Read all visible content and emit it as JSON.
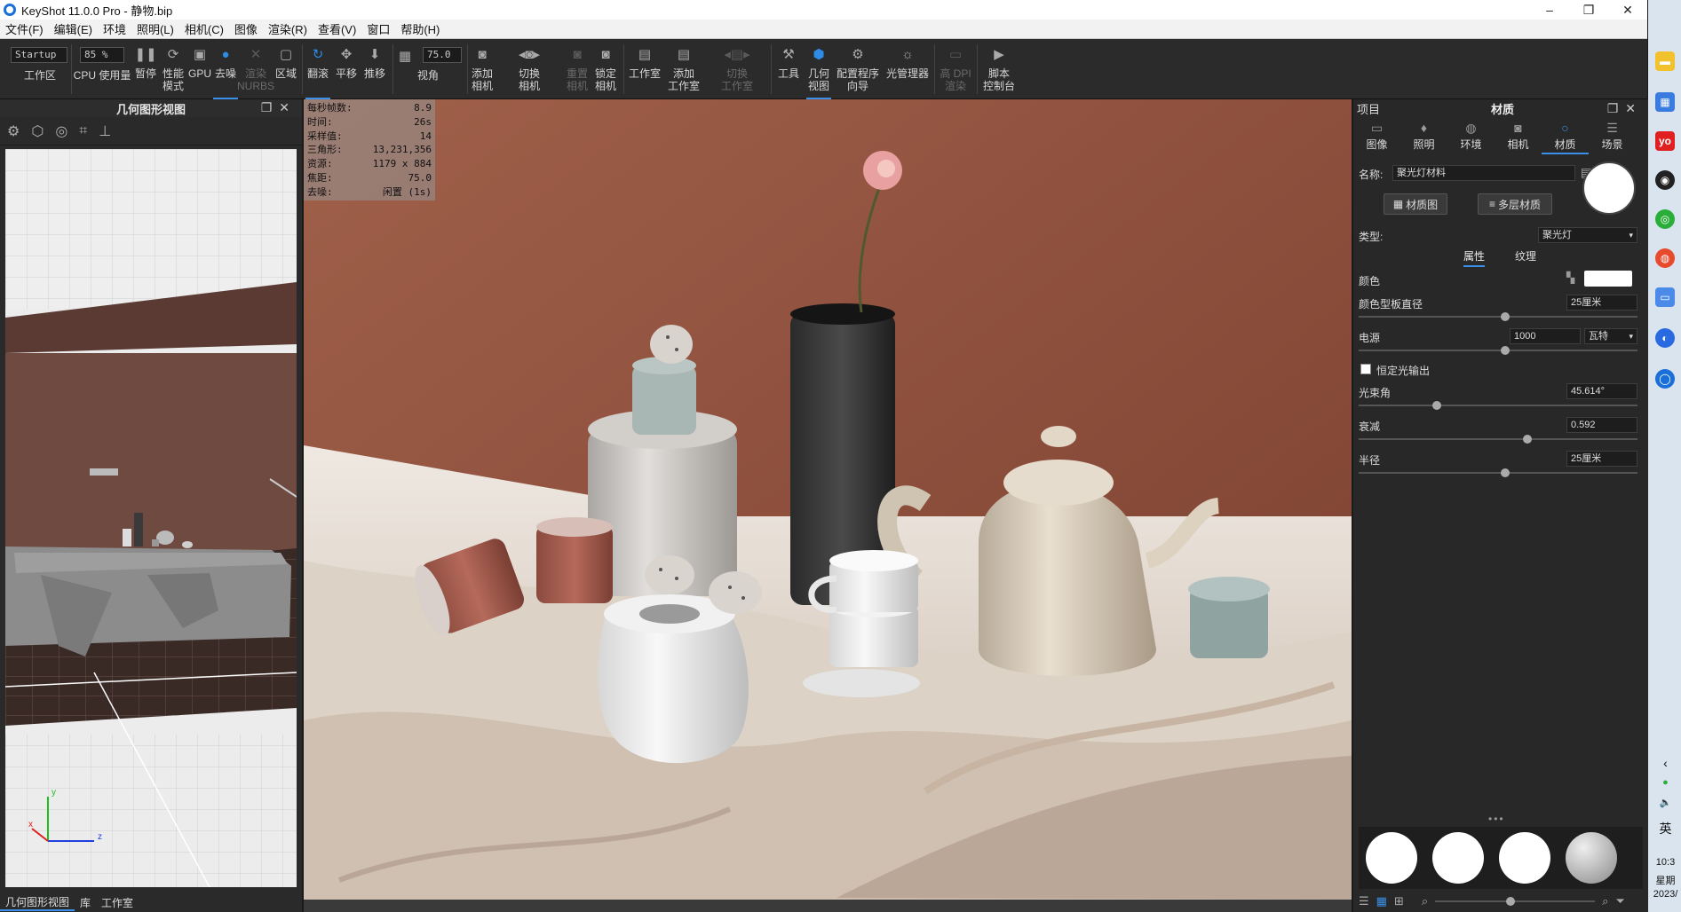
{
  "app": {
    "title": "KeyShot 11.0.0 Pro  - 静物.bip",
    "window_controls": [
      "–",
      "❐",
      "✕"
    ]
  },
  "menu": [
    "文件(F)",
    "编辑(E)",
    "环境",
    "照明(L)",
    "相机(C)",
    "图像",
    "渲染(R)",
    "查看(V)",
    "窗口",
    "帮助(H)"
  ],
  "toolbar": {
    "workspace_select": "Startup",
    "workspace_label": "工作区",
    "cpu_percent": "85 %",
    "cpu_label": "CPU 使用量",
    "pause": "暂停",
    "perf": "性能\n模式",
    "gpu": "GPU",
    "denoise": "去噪",
    "nurbs": "渲染\nNURBS",
    "region": "区域",
    "tumble": "翻滚",
    "pan": "平移",
    "dolly": "推移",
    "fov_value": "75.0",
    "fov_label": "视角",
    "add_camera": "添加\n相机",
    "switch_camera": "切换\n相机",
    "reset_camera": "重置\n相机",
    "lock_camera": "锁定\n相机",
    "studio": "工作室",
    "add_studio": "添加\n工作室",
    "switch_studio": "切换\n工作室",
    "tools": "工具",
    "geo_view": "几何\n视图",
    "config_wizard": "配置程序\n向导",
    "light_manager": "光管理器",
    "hidpi": "高 DPI\n渲染",
    "script_console": "脚本\n控制台"
  },
  "geometry_panel": {
    "title": "几何图形视图",
    "axis": {
      "y": "y",
      "x": "x",
      "z": "z"
    }
  },
  "left_footer": {
    "tabs": [
      "几何图形视图",
      "库",
      "工作室"
    ]
  },
  "hud": [
    {
      "k": "每秒帧数:",
      "v": "8.9"
    },
    {
      "k": "时间:",
      "v": "26s"
    },
    {
      "k": "采样值:",
      "v": "14"
    },
    {
      "k": "三角形:",
      "v": "13,231,356"
    },
    {
      "k": "资源:",
      "v": "1179 x 884"
    },
    {
      "k": "焦距:",
      "v": "75.0"
    },
    {
      "k": "去噪:",
      "v": "闲置 (1s)"
    }
  ],
  "right_panel": {
    "project": "项目",
    "material_title": "材质",
    "tabs": [
      "图像",
      "照明",
      "环境",
      "相机",
      "材质",
      "场景"
    ],
    "name_label": "名称:",
    "name_value": "聚光灯材料",
    "material_graph": "材质图",
    "multi_layer": "多层材质",
    "type_label": "类型:",
    "type_value": "聚光灯",
    "sub_tabs": [
      "属性",
      "纹理"
    ],
    "color_label": "颜色",
    "diameter_label": "颜色型板直径",
    "diameter_value": "25厘米",
    "power_label": "电源",
    "power_value": "1000",
    "power_unit": "瓦特",
    "constant_output": "恒定光输出",
    "beam_label": "光束角",
    "beam_value": "45.614°",
    "falloff_label": "衰减",
    "falloff_value": "0.592",
    "radius_label": "半径",
    "radius_value": "25厘米",
    "dots": "•••"
  },
  "taskbar": {
    "ime": "英",
    "time": "10:3",
    "weekday": "星期",
    "date": "2023/"
  }
}
